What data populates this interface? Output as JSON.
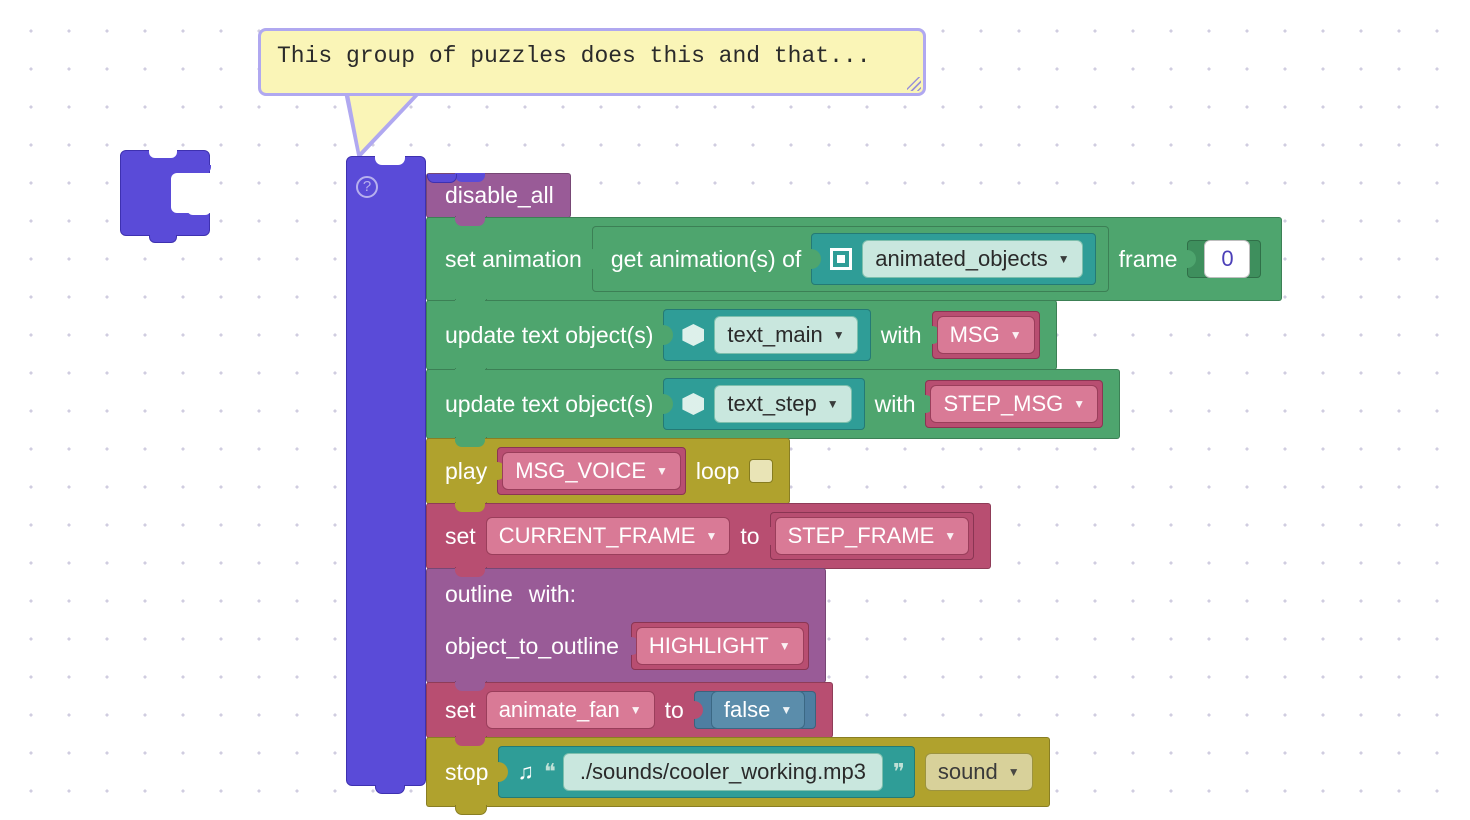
{
  "comment": {
    "text": "This group of puzzles does this and that..."
  },
  "help": "?",
  "blocks": {
    "b1": {
      "label": "disable_all"
    },
    "b2": {
      "label_set": "set animation",
      "label_get": "get animation(s) of",
      "object": "animated_objects",
      "label_frame": "frame",
      "frame_value": "0"
    },
    "b3": {
      "label": "update text object(s)",
      "object": "text_main",
      "with": "with",
      "var": "MSG"
    },
    "b4": {
      "label": "update text object(s)",
      "object": "text_step",
      "with": "with",
      "var": "STEP_MSG"
    },
    "b5": {
      "label_play": "play",
      "var": "MSG_VOICE",
      "label_loop": "loop"
    },
    "b6": {
      "label_set": "set",
      "var_l": "CURRENT_FRAME",
      "label_to": "to",
      "var_r": "STEP_FRAME"
    },
    "b7": {
      "label_a": "outline",
      "label_with": "with:",
      "label_b": "object_to_outline",
      "var": "HIGHLIGHT"
    },
    "b8": {
      "label_set": "set",
      "var": "animate_fan",
      "label_to": "to",
      "val": "false"
    },
    "b9": {
      "label_stop": "stop",
      "path": "./sounds/cooler_working.mp3",
      "label_sound": "sound"
    }
  }
}
